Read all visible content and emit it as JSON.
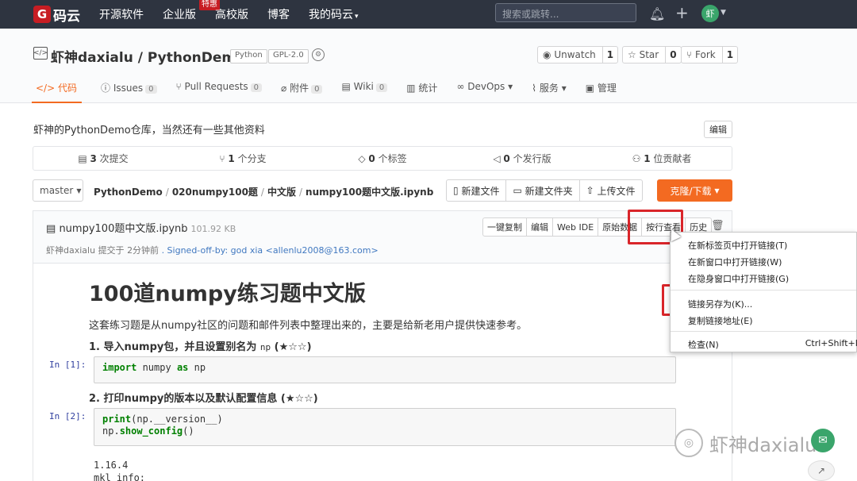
{
  "topnav": {
    "logo_mark": "G",
    "logo_text": "码云",
    "links": [
      "开源软件",
      "企业版",
      "高校版",
      "博客",
      "我的码云"
    ],
    "hot_badge": "特惠",
    "search_placeholder": "搜索或跳转...",
    "avatar_text": "虾",
    "bg_color": "#2e3440"
  },
  "repo": {
    "title": "虾神daxialu / PythonDemo",
    "tag_lang": "Python",
    "tag_license": "GPL-2.0",
    "watch_label": "Unwatch",
    "watch_count": "1",
    "star_label": "Star",
    "star_count": "0",
    "fork_label": "Fork",
    "fork_count": "1"
  },
  "tabs": [
    {
      "label": "代码",
      "count": ""
    },
    {
      "label": "Issues",
      "count": "0"
    },
    {
      "label": "Pull Requests",
      "count": "0"
    },
    {
      "label": "附件",
      "count": "0"
    },
    {
      "label": "Wiki",
      "count": "0"
    },
    {
      "label": "统计",
      "count": ""
    },
    {
      "label": "DevOps",
      "count": ""
    },
    {
      "label": "服务",
      "count": ""
    },
    {
      "label": "管理",
      "count": ""
    }
  ],
  "description": "虾神的PythonDemo仓库，当然还有一些其他资料",
  "edit_label": "编辑",
  "stats": [
    {
      "num": "3",
      "label": "次提交"
    },
    {
      "num": "1",
      "label": "个分支"
    },
    {
      "num": "0",
      "label": "个标签"
    },
    {
      "num": "0",
      "label": "个发行版"
    },
    {
      "num": "1",
      "label": "位贡献者"
    }
  ],
  "branch": "master",
  "path": [
    "PythonDemo",
    "020numpy100题",
    "中文版",
    "numpy100题中文版.ipynb"
  ],
  "path_buttons": [
    "新建文件",
    "新建文件夹",
    "上传文件"
  ],
  "clone_label": "克隆/下载",
  "file": {
    "name": "numpy100题中文版.ipynb",
    "size": "101.92 KB",
    "commit_author": "虾神daxialu",
    "commit_text": "提交于",
    "commit_time": "2分钟前",
    "commit_msg": ". Signed-off-by: god xia <allenlu2008@163.com>",
    "buttons": [
      "一键复制",
      "编辑",
      "Web IDE",
      "原始数据",
      "按行查看",
      "历史"
    ]
  },
  "notebook": {
    "title": "100道numpy练习题中文版",
    "para": "这套练习题是从numpy社区的问题和邮件列表中整理出来的，主要是给新老用户提供快速参考。",
    "h1": "1. 导入numpy包，并且设置别名为",
    "h1_code": "np",
    "h1_stars": "(★☆☆)",
    "prompt1": "In [1]:",
    "code1_kw1": "import",
    "code1_mid": " numpy ",
    "code1_kw2": "as",
    "code1_end": " np",
    "h2": "2. 打印numpy的版本以及默认配置信息",
    "h2_stars": "(★☆☆)",
    "prompt2": "In [2]:",
    "code2_fn1": "print",
    "code2_rest1": "(np.__version__)",
    "code2_pre2": "np.",
    "code2_fn2": "show_config",
    "code2_rest2": "()",
    "out1": "1.16.4",
    "out2": "mkl_info:"
  },
  "context_menu": {
    "items": [
      "在新标签页中打开链接(T)",
      "在新窗口中打开链接(W)",
      "在隐身窗口中打开链接(G)",
      "链接另存为(K)...",
      "复制链接地址(E)",
      "检查(N)"
    ],
    "inspect_shortcut": "Ctrl+Shift+I"
  },
  "watermark": {
    "text": "虾神daxialu"
  },
  "colors": {
    "accent": "#f36a21",
    "brand": "#c71d23",
    "highlight": "#d9252a",
    "link": "#4078c0"
  }
}
